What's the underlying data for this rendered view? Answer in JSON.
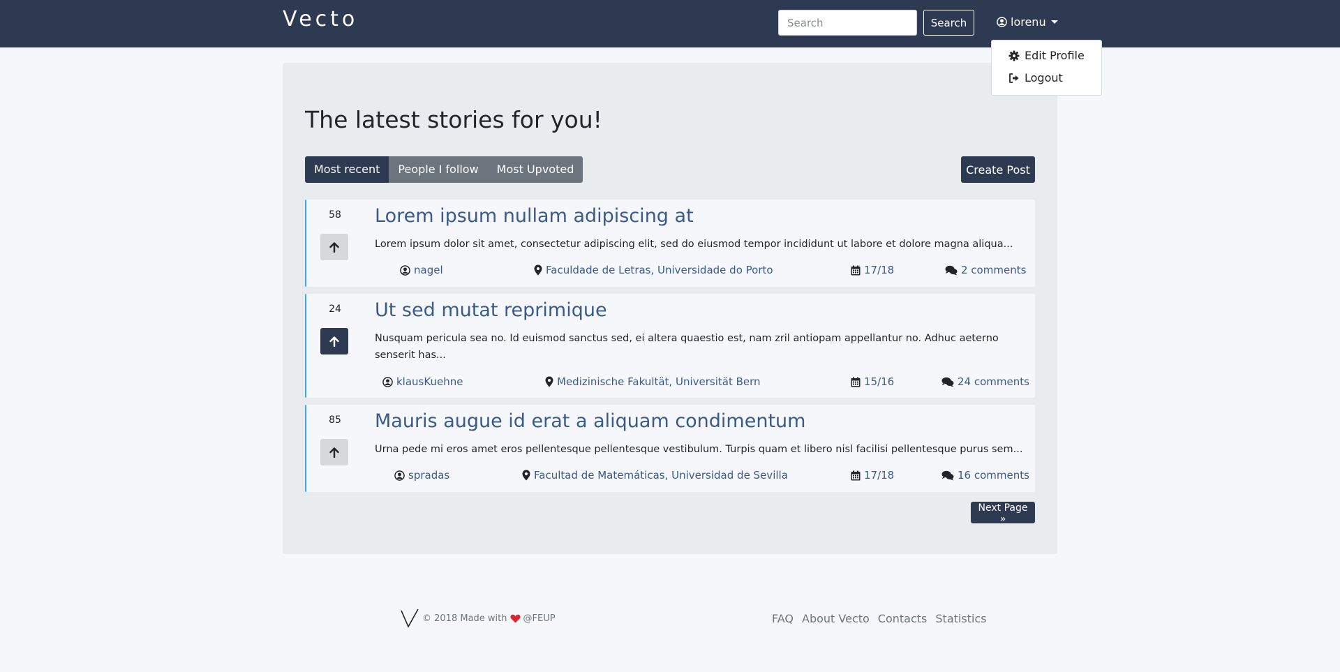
{
  "navbar": {
    "brand": "Vecto",
    "search_placeholder": "Search",
    "search_button": "Search",
    "username": "lorenu"
  },
  "user_menu": {
    "items": [
      {
        "label": "Edit Profile",
        "icon": "gear-icon"
      },
      {
        "label": "Logout",
        "icon": "sign-out-icon"
      }
    ]
  },
  "main": {
    "title": "The latest stories for you!",
    "tabs": [
      {
        "label": "Most recent",
        "active": true
      },
      {
        "label": "People I follow",
        "active": false
      },
      {
        "label": "Most Upvoted",
        "active": false
      }
    ],
    "create_post": "Create Post",
    "next_page": "Next Page »"
  },
  "posts": [
    {
      "votes": "58",
      "voted": false,
      "title": "Lorem ipsum nullam adipiscing at",
      "excerpt": "Lorem ipsum dolor sit amet, consectetur adipiscing elit, sed do eiusmod tempor incididunt ut labore et dolore magna aliqua...",
      "author": "nagel",
      "location": "Faculdade de Letras, Universidade do Porto",
      "date": "17/18",
      "comments": "2 comments"
    },
    {
      "votes": "24",
      "voted": true,
      "title": "Ut sed mutat reprimique",
      "excerpt": "Nusquam pericula sea no. Id euismod sanctus sed, ei altera quaestio est, nam zril antiopam appellantur no. Adhuc aeterno senserit has...",
      "author": "klausKuehne",
      "location": "Medizinische Fakultät, Universität Bern",
      "date": "15/16",
      "comments": "24 comments"
    },
    {
      "votes": "85",
      "voted": false,
      "title": "Mauris augue id erat a aliquam condimentum",
      "excerpt": "Urna pede mi eros amet eros pellentesque pellentesque vestibulum. Turpis quam et libero nisl facilisi pellentesque purus sem...",
      "author": "spradas",
      "location": "Facultad de Matemáticas, Universidad de Sevilla",
      "date": "17/18",
      "comments": "16 comments"
    }
  ],
  "footer": {
    "made_prefix": "© 2018 Made with",
    "made_suffix": "@FEUP",
    "links": [
      "FAQ",
      "About Vecto",
      "Contacts",
      "Statistics"
    ]
  },
  "colors": {
    "navbar": "#2e3a52",
    "accent_link": "#3b5a8c",
    "post_border": "#3da5ff",
    "heart": "#e0242f"
  }
}
